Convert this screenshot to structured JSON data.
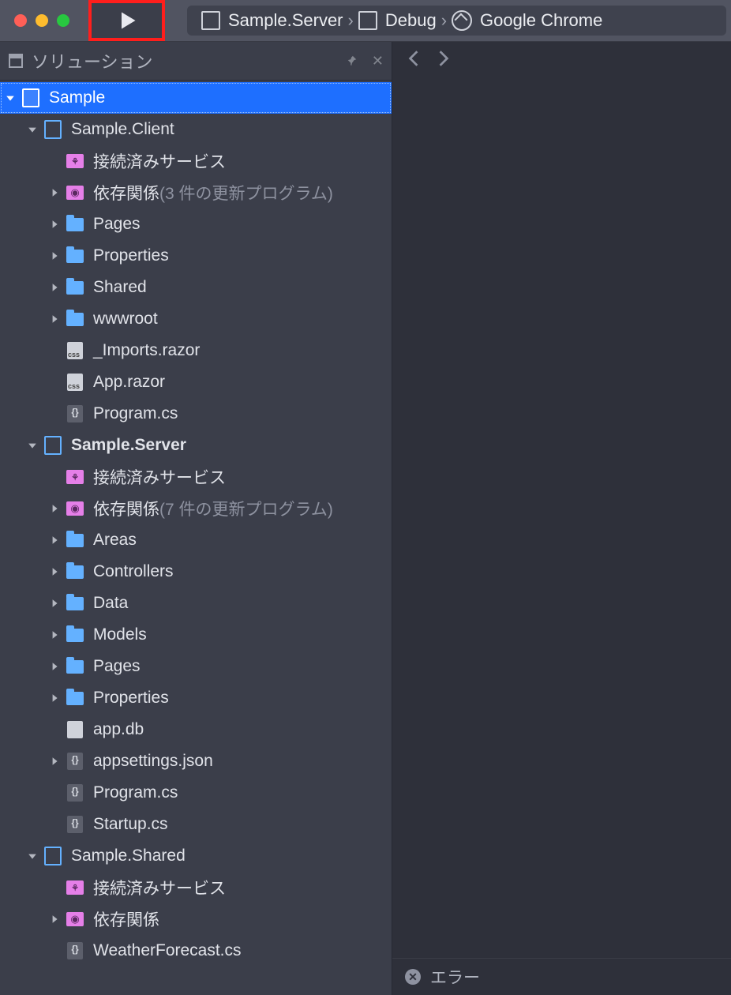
{
  "toolbar": {
    "target_project": "Sample.Server",
    "configuration": "Debug",
    "browser": "Google Chrome"
  },
  "solution_panel": {
    "title": "ソリューション"
  },
  "tree": [
    {
      "d": 0,
      "k": "sln",
      "exp": "open",
      "sel": true,
      "label": "Sample"
    },
    {
      "d": 1,
      "k": "proj",
      "exp": "open",
      "label": "Sample.Client"
    },
    {
      "d": 2,
      "k": "svc",
      "exp": "none",
      "label": "接続済みサービス"
    },
    {
      "d": 2,
      "k": "pkg",
      "exp": "closed",
      "label": "依存関係",
      "suffix": "(3 件の更新プログラム)"
    },
    {
      "d": 2,
      "k": "folder",
      "exp": "closed",
      "label": "Pages"
    },
    {
      "d": 2,
      "k": "folder",
      "exp": "closed",
      "label": "Properties"
    },
    {
      "d": 2,
      "k": "folder",
      "exp": "closed",
      "label": "Shared"
    },
    {
      "d": 2,
      "k": "folder",
      "exp": "closed",
      "label": "wwwroot"
    },
    {
      "d": 2,
      "k": "css",
      "exp": "none",
      "label": "_Imports.razor"
    },
    {
      "d": 2,
      "k": "css",
      "exp": "none",
      "label": "App.razor"
    },
    {
      "d": 2,
      "k": "cs",
      "exp": "none",
      "label": "Program.cs"
    },
    {
      "d": 1,
      "k": "proj",
      "exp": "open",
      "bold": true,
      "label": "Sample.Server"
    },
    {
      "d": 2,
      "k": "svc",
      "exp": "none",
      "label": "接続済みサービス"
    },
    {
      "d": 2,
      "k": "pkg",
      "exp": "closed",
      "label": "依存関係",
      "suffix": "(7 件の更新プログラム)"
    },
    {
      "d": 2,
      "k": "folder",
      "exp": "closed",
      "label": "Areas"
    },
    {
      "d": 2,
      "k": "folder",
      "exp": "closed",
      "label": "Controllers"
    },
    {
      "d": 2,
      "k": "folder",
      "exp": "closed",
      "label": "Data"
    },
    {
      "d": 2,
      "k": "folder",
      "exp": "closed",
      "label": "Models"
    },
    {
      "d": 2,
      "k": "folder",
      "exp": "closed",
      "label": "Pages"
    },
    {
      "d": 2,
      "k": "folder",
      "exp": "closed",
      "label": "Properties"
    },
    {
      "d": 2,
      "k": "file",
      "exp": "none",
      "label": "app.db"
    },
    {
      "d": 2,
      "k": "cs",
      "exp": "closed",
      "label": "appsettings.json"
    },
    {
      "d": 2,
      "k": "cs",
      "exp": "none",
      "label": "Program.cs"
    },
    {
      "d": 2,
      "k": "cs",
      "exp": "none",
      "label": "Startup.cs"
    },
    {
      "d": 1,
      "k": "proj",
      "exp": "open",
      "label": "Sample.Shared"
    },
    {
      "d": 2,
      "k": "svc",
      "exp": "none",
      "label": "接続済みサービス"
    },
    {
      "d": 2,
      "k": "pkg",
      "exp": "closed",
      "label": "依存関係"
    },
    {
      "d": 2,
      "k": "cs",
      "exp": "none",
      "label": "WeatherForecast.cs"
    }
  ],
  "error_panel": {
    "label": "エラー"
  }
}
